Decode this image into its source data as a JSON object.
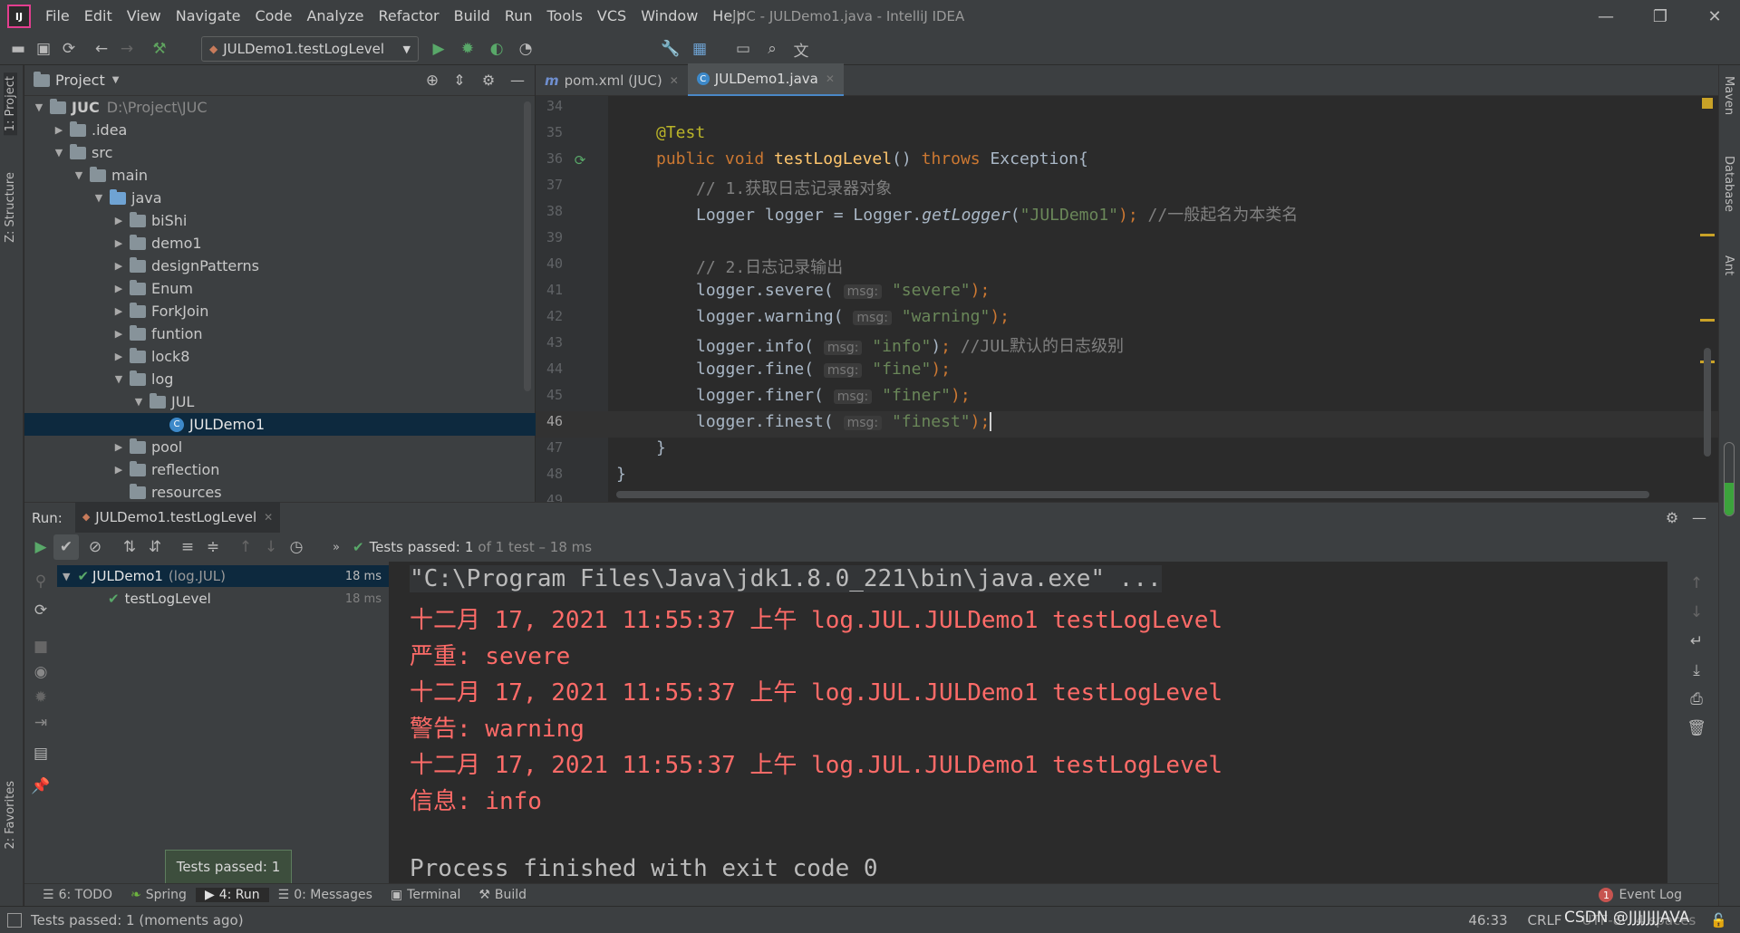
{
  "window": {
    "app_title": "JUC - JULDemo1.java - IntelliJ IDEA",
    "menu": [
      "File",
      "Edit",
      "View",
      "Navigate",
      "Code",
      "Analyze",
      "Refactor",
      "Build",
      "Run",
      "Tools",
      "VCS",
      "Window",
      "Help"
    ]
  },
  "toolbar": {
    "run_config": "JULDemo1.testLogLevel"
  },
  "left_strip": {
    "project_tab": "1: Project",
    "structure_tab": "Z: Structure",
    "favorites_tab": "2: Favorites"
  },
  "right_strip": {
    "maven": "Maven",
    "database": "Database",
    "ant": "Ant"
  },
  "project": {
    "title": "Project",
    "root_name": "JUC",
    "root_path": "D:\\Project\\JUC",
    "tree": [
      {
        "label": "JUC",
        "depth": 0,
        "arrow": "▼"
      },
      {
        "label": ".idea",
        "depth": 1,
        "arrow": "▶"
      },
      {
        "label": "src",
        "depth": 1,
        "arrow": "▼"
      },
      {
        "label": "main",
        "depth": 2,
        "arrow": "▼"
      },
      {
        "label": "java",
        "depth": 3,
        "arrow": "▼"
      },
      {
        "label": "biShi",
        "depth": 4,
        "arrow": "▶"
      },
      {
        "label": "demo1",
        "depth": 4,
        "arrow": "▶"
      },
      {
        "label": "designPatterns",
        "depth": 4,
        "arrow": "▶"
      },
      {
        "label": "Enum",
        "depth": 4,
        "arrow": "▶"
      },
      {
        "label": "ForkJoin",
        "depth": 4,
        "arrow": "▶"
      },
      {
        "label": "funtion",
        "depth": 4,
        "arrow": "▶"
      },
      {
        "label": "lock8",
        "depth": 4,
        "arrow": "▶"
      },
      {
        "label": "log",
        "depth": 4,
        "arrow": "▼"
      },
      {
        "label": "JUL",
        "depth": 5,
        "arrow": "▼"
      },
      {
        "label": "JULDemo1",
        "depth": 6,
        "arrow": ""
      },
      {
        "label": "pool",
        "depth": 4,
        "arrow": "▶"
      },
      {
        "label": "reflection",
        "depth": 4,
        "arrow": "▶"
      },
      {
        "label": "resources",
        "depth": 3,
        "arrow": ""
      }
    ]
  },
  "editor": {
    "tabs": [
      "pom.xml (JUC)",
      "JULDemo1.java"
    ],
    "active_tab": "JULDemo1.java",
    "line_numbers": [
      "34",
      "35",
      "36",
      "37",
      "38",
      "39",
      "40",
      "41",
      "42",
      "43",
      "44",
      "45",
      "46",
      "47",
      "48",
      "49"
    ],
    "code": {
      "l35": "@Test",
      "l36_public": "public ",
      "l36_void": "void ",
      "l36_name": "testLogLevel",
      "l36_paren": "() ",
      "l36_throws": "throws ",
      "l36_rest": "Exception{",
      "l37": "// 1.获取日志记录器对象",
      "l38_a": "Logger logger = Logger.",
      "l38_b": "getLogger",
      "l38_c": "(",
      "l38_d": "\"JULDemo1\"",
      "l38_e": "); ",
      "l38_f": "//一般起名为本类名",
      "l40": "// 2.日志记录输出",
      "l41_a": "logger.severe(",
      "l41_s": "\"severe\"",
      "l42_a": "logger.warning(",
      "l42_s": "\"warning\"",
      "l43_a": "logger.info(",
      "l43_s": "\"info\"",
      "l43_c": "//JUL默认的日志级别",
      "l44_a": "logger.fine(",
      "l44_s": "\"fine\"",
      "l45_a": "logger.finer(",
      "l45_s": "\"finer\"",
      "l46_a": "logger.finest(",
      "l46_s": "\"finest\"",
      "end": ");",
      "semi": "; ",
      "hint": "msg:",
      "l47": "}",
      "l48": "}"
    }
  },
  "run": {
    "label": "Run:",
    "tab": "JULDemo1.testLogLevel",
    "status_prefix": "Tests passed:",
    "status_count": "1",
    "status_suffix": "of 1 test – 18 ms",
    "tree": [
      {
        "name": "JULDemo1",
        "detail": "(log.JUL)",
        "time": "18 ms"
      },
      {
        "name": "testLogLevel",
        "detail": "",
        "time": "18 ms"
      }
    ],
    "console": [
      {
        "text": "\"C:\\Program Files\\Java\\jdk1.8.0_221\\bin\\java.exe\" ...",
        "color": "gray"
      },
      {
        "text": "十二月 17, 2021 11:55:37 上午 log.JUL.JULDemo1 testLogLevel",
        "color": "red"
      },
      {
        "text": "严重: severe",
        "color": "red"
      },
      {
        "text": "十二月 17, 2021 11:55:37 上午 log.JUL.JULDemo1 testLogLevel",
        "color": "red"
      },
      {
        "text": "警告: warning",
        "color": "red"
      },
      {
        "text": "十二月 17, 2021 11:55:37 上午 log.JUL.JULDemo1 testLogLevel",
        "color": "red"
      },
      {
        "text": "信息: info",
        "color": "red"
      },
      {
        "text": "",
        "color": "gray"
      },
      {
        "text": "Process finished with exit code 0",
        "color": "gray"
      }
    ]
  },
  "tooltip": "Tests passed: 1",
  "bottom_tabs": [
    "6: TODO",
    "Spring",
    "4: Run",
    "0: Messages",
    "Terminal",
    "Build"
  ],
  "event_log": {
    "label": "Event Log",
    "count": "1"
  },
  "status": {
    "message": "Tests passed: 1 (moments ago)",
    "position": "46:33",
    "line_sep": "CRLF",
    "encoding": "UTF-8",
    "indent": "4 spaces",
    "watermark": "CSDN @JJJJJJJAVA"
  }
}
